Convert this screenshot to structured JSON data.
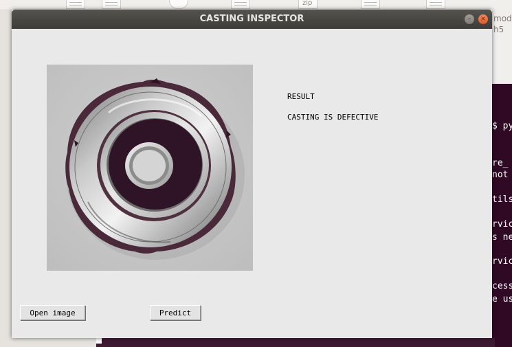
{
  "window": {
    "title": "CASTING INSPECTOR",
    "minimize_glyph": "–",
    "close_glyph": "×"
  },
  "result": {
    "heading": "RESULT",
    "value": "CASTING IS DEFECTIVE"
  },
  "buttons": {
    "open_image": "Open image",
    "predict": "Predict"
  },
  "background": {
    "zip_label": "zip",
    "right_file_labels": [
      "mod",
      "h5"
    ],
    "terminal_lines": [
      "$ py",
      "re_",
      "not",
      "tils",
      "rvic",
      "s ne",
      "rvic",
      "cess",
      "e us"
    ]
  },
  "colors": {
    "titlebar": "#3d3c38",
    "window_bg": "#e9e9e9",
    "terminal_bg": "#300a24",
    "close_button": "#df5b2a"
  }
}
